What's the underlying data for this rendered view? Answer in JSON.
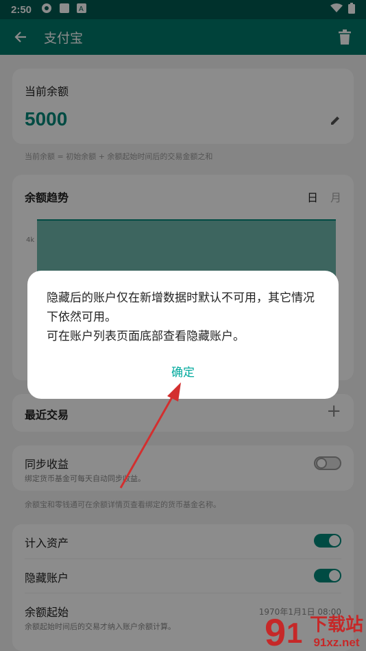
{
  "status_bar": {
    "time": "2:50"
  },
  "app_bar": {
    "title": "支付宝"
  },
  "balance": {
    "label": "当前余额",
    "value": "5000",
    "hint": "当前余额 = 初始余额 + 余额起始时间后的交易金额之和"
  },
  "trend": {
    "label": "余额趋势",
    "day": "日",
    "month": "月",
    "y_tick": "4k"
  },
  "recent": {
    "label": "最近交易"
  },
  "sync": {
    "label": "同步收益",
    "sub": "绑定货币基金可每天自动同步收益。",
    "hint": "余额宝和零钱通可在余额详情页查看绑定的货币基金名称。"
  },
  "settings": {
    "include_assets": "计入资产",
    "hide_account": "隐藏账户",
    "balance_start": "余额起始",
    "balance_start_value": "1970年1月1日 08:00",
    "balance_start_sub": "余额起始时间后的交易才纳入账户余额计算。"
  },
  "dialog": {
    "line1": "隐藏后的账户仅在新增数据时默认不可用，其它情况下依然可用。",
    "line2": "可在账户列表页面底部查看隐藏账户。",
    "confirm": "确定"
  },
  "watermark": {
    "big": "下载站",
    "small": "91xz.net"
  },
  "colors": {
    "primary": "#00796b",
    "accent": "#00a99d"
  }
}
